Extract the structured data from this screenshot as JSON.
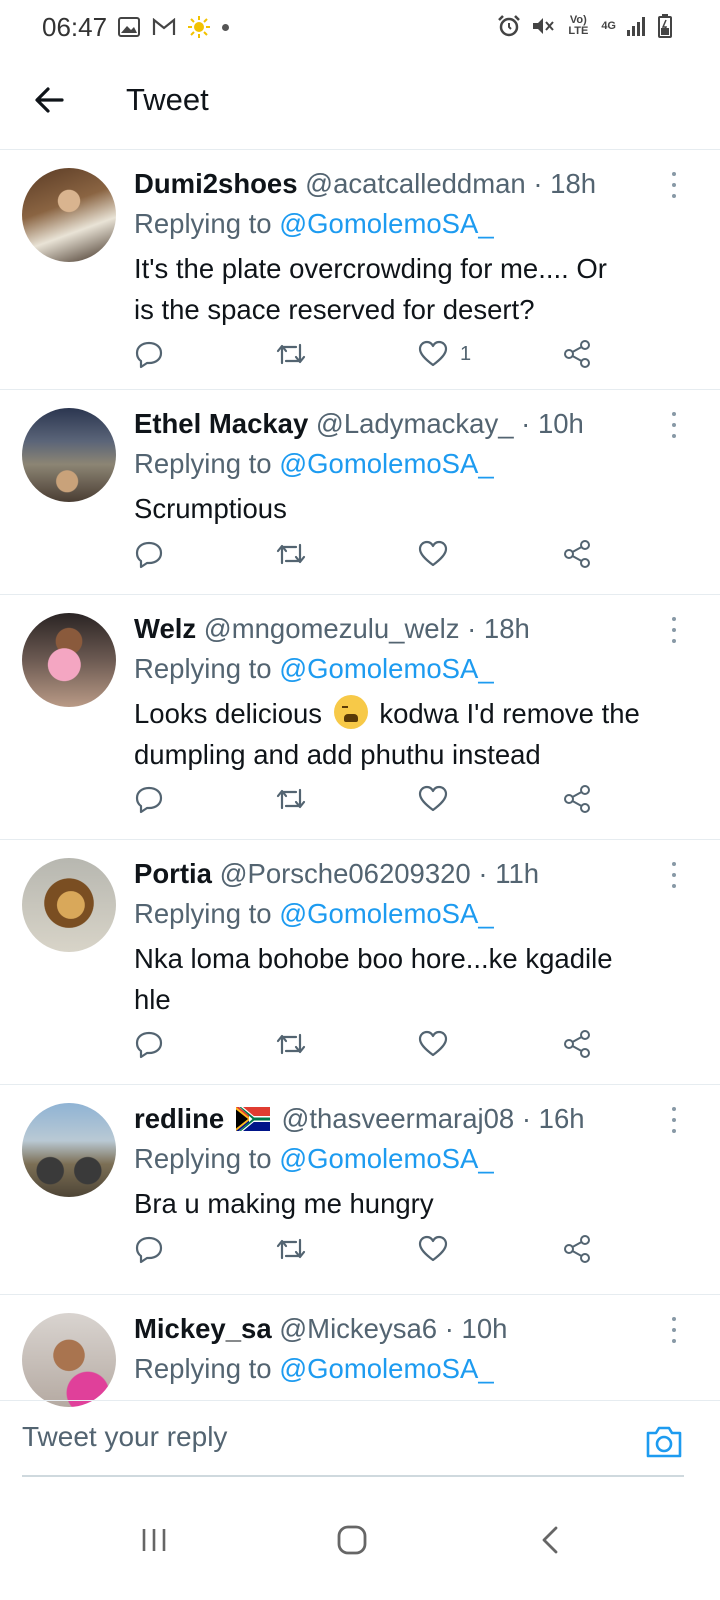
{
  "status_bar": {
    "time": "06:47",
    "network_label": "4G",
    "volte_label": "Vo) LTE",
    "icons": [
      "gallery-icon",
      "gmail-icon",
      "sun-icon",
      "dot-icon",
      "alarm-icon",
      "mute-icon",
      "volte-icon",
      "4g-icon",
      "signal-icon",
      "battery-icon"
    ]
  },
  "header": {
    "title": "Tweet"
  },
  "replying_label": "Replying to",
  "tweets": [
    {
      "name": "Dumi2shoes",
      "handle": "@acatcalleddman",
      "time": "18h",
      "reply_to": "@GomolemoSA_",
      "text_lines": [
        "It's the plate overcrowding for me.... Or",
        "is the space reserved for desert?"
      ],
      "like_count": "1"
    },
    {
      "name": "Ethel Mackay",
      "handle": "@Ladymackay_",
      "time": "10h",
      "reply_to": "@GomolemoSA_",
      "text_lines": [
        "Scrumptious"
      ],
      "like_count": ""
    },
    {
      "name": "Welz",
      "handle": "@mngomezulu_welz",
      "time": "18h",
      "reply_to": "@GomolemoSA_",
      "text_before_emoji": "Looks delicious",
      "text_after_emoji": "kodwa I'd remove the",
      "text_line2": "dumpling and add phuthu instead",
      "like_count": ""
    },
    {
      "name": "Portia",
      "handle": "@Porsche06209320",
      "time": "11h",
      "reply_to": "@GomolemoSA_",
      "text_lines": [
        "Nka loma bohobe boo hore...ke kgadile",
        "hle"
      ],
      "like_count": ""
    },
    {
      "name": "redline",
      "handle": "@thasveermaraj08",
      "time": "16h",
      "reply_to": "@GomolemoSA_",
      "text_lines": [
        "Bra u making me hungry"
      ],
      "like_count": ""
    },
    {
      "name": "Mickey_sa",
      "handle": "@Mickeysa6",
      "time": "10h",
      "reply_to": "@GomolemoSA_",
      "text_lines": [
        ""
      ],
      "like_count": ""
    }
  ],
  "composer": {
    "placeholder": "Tweet your reply"
  },
  "colors": {
    "accent": "#1d9bf0",
    "secondary_text": "#536471",
    "divider": "#e6ecf0"
  }
}
